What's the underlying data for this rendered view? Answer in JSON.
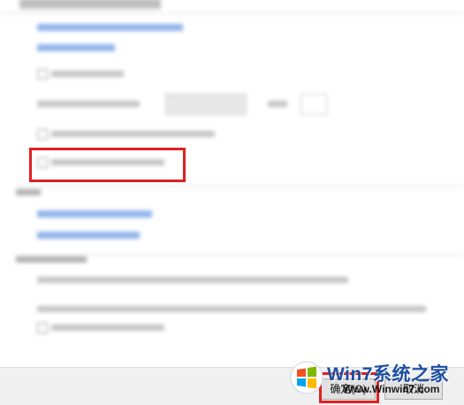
{
  "footer": {
    "ok_label": "确定(O)",
    "cancel_label": "取消"
  },
  "watermark": {
    "brand": "Win7系统之家",
    "url": "Www.Winwin7.com"
  }
}
